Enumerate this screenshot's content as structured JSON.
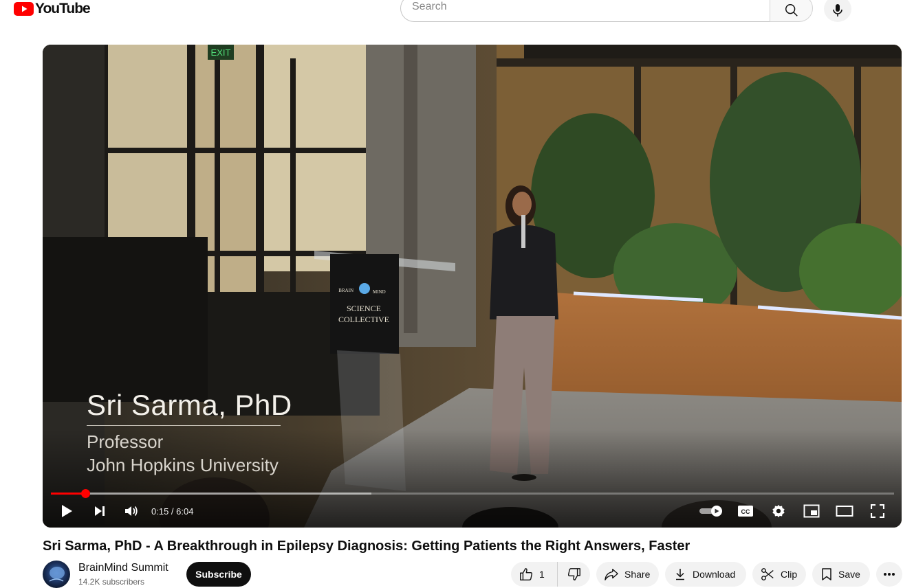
{
  "header": {
    "logo_text": "YouTube",
    "search_placeholder": "Search",
    "icons": [
      "youtube-logo-icon",
      "search-icon",
      "mic-icon"
    ]
  },
  "video": {
    "overlay": {
      "name": "Sri Sarma, PhD",
      "role": "Professor",
      "organization": "John Hopkins University"
    },
    "scene_text": {
      "podium_brand_top": "BRAIN",
      "podium_brand_right": "MIND",
      "podium_line1": "SCIENCE",
      "podium_line2": "COLLECTIVE",
      "exit_sign": "EXIT"
    },
    "time_display": "0:15 / 6:04",
    "played_fraction": 0.041,
    "buffered_fraction": 0.38,
    "controls": [
      "play-icon",
      "next-icon",
      "volume-icon",
      "autoplay-toggle-icon",
      "captions-icon",
      "settings-icon",
      "miniplayer-icon",
      "theater-icon",
      "fullscreen-icon"
    ],
    "progress_color": "#ff0000"
  },
  "meta": {
    "title": "Sri Sarma, PhD - A Breakthrough in Epilepsy Diagnosis: Getting Patients the Right Answers, Faster",
    "channel_name": "BrainMind Summit",
    "subscribers": "14.2K subscribers",
    "subscribe_label": "Subscribe",
    "like_count": "1",
    "share_label": "Share",
    "download_label": "Download",
    "clip_label": "Clip",
    "save_label": "Save"
  }
}
